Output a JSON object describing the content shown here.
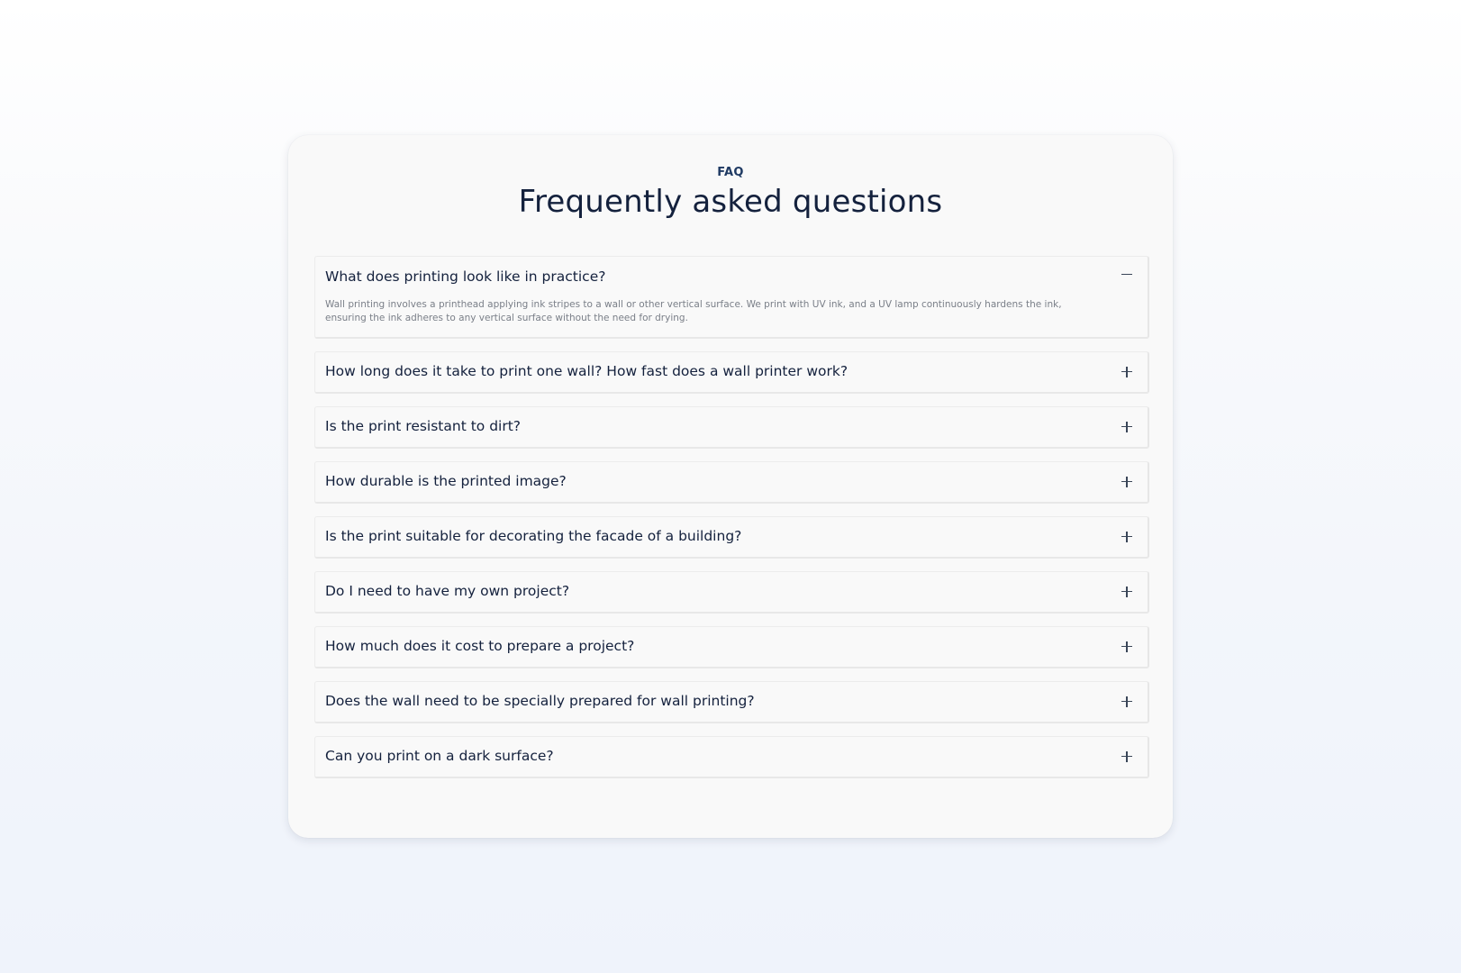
{
  "header": {
    "eyebrow": "FAQ",
    "title": "Frequently asked questions"
  },
  "faq": [
    {
      "question": "What does printing look like in practice?",
      "answer": "Wall printing involves a printhead applying ink stripes to a wall or other vertical surface. We print with UV ink, and a UV lamp continuously hardens the ink, ensuring the ink adheres to any vertical surface without the need for drying.",
      "expanded": true,
      "toggle_icon": "minus-icon"
    },
    {
      "question": "How long does it take to print one wall? How fast does a wall printer work?",
      "expanded": false,
      "toggle_icon": "plus-icon"
    },
    {
      "question": "Is the print resistant to dirt?",
      "expanded": false,
      "toggle_icon": "plus-icon"
    },
    {
      "question": "How durable is the printed image?",
      "expanded": false,
      "toggle_icon": "plus-icon"
    },
    {
      "question": "Is the print suitable for decorating the facade of a building?",
      "expanded": false,
      "toggle_icon": "plus-icon"
    },
    {
      "question": "Do I need to have my own project?",
      "expanded": false,
      "toggle_icon": "plus-icon"
    },
    {
      "question": "How much does it cost to prepare a project?",
      "expanded": false,
      "toggle_icon": "plus-icon"
    },
    {
      "question": "Does the wall need to be specially prepared for wall printing?",
      "expanded": false,
      "toggle_icon": "plus-icon"
    },
    {
      "question": "Can you print on a dark surface?",
      "expanded": false,
      "toggle_icon": "plus-icon"
    }
  ],
  "colors": {
    "text_primary": "#14213d",
    "eyebrow": "#1f3a63",
    "answer_text": "#7a7f88",
    "card_background": "#f9f9f9"
  }
}
